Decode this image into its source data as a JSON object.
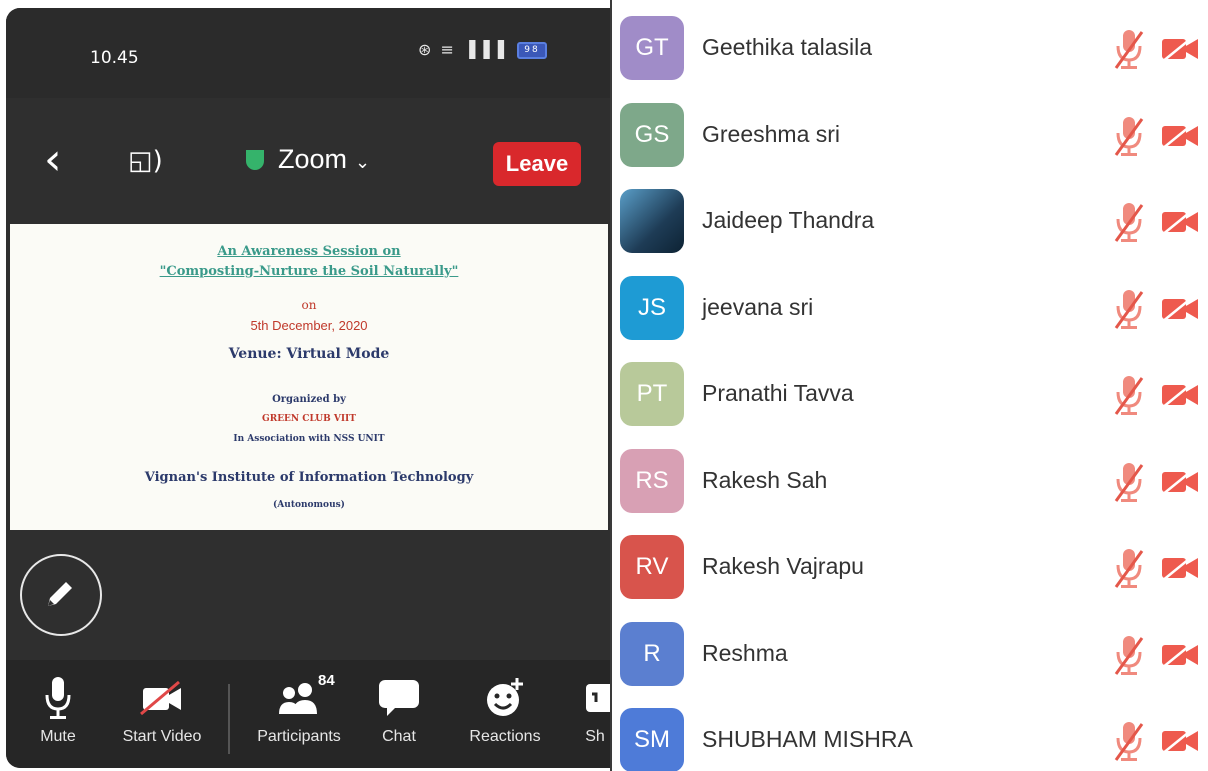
{
  "status_bar": {
    "time": "10.45",
    "signal": "⊛ ≡ ▐▐▐",
    "battery": "98"
  },
  "meeting": {
    "title": "Zoom",
    "leave_label": "Leave"
  },
  "shared_doc": {
    "line1": "An Awareness Session on",
    "line2": "\"Composting-Nurture the Soil Naturally\"",
    "line3": "on",
    "line4": "5th December, 2020",
    "line5": "Venue: Virtual Mode",
    "line6": "Organized by",
    "line7": "GREEN CLUB VIIT",
    "line8": "In Association with NSS UNIT",
    "line9": "Vignan's Institute of Information Technology",
    "line10": "(Autonomous)"
  },
  "toolbar": {
    "mute_label": "Mute",
    "video_label": "Start Video",
    "participants_label": "Participants",
    "participants_count": "84",
    "chat_label": "Chat",
    "reactions_label": "Reactions",
    "share_label": "Sh"
  },
  "participants": [
    {
      "initials": "GT",
      "name": "Geethika talasila",
      "color": "#a08cc8"
    },
    {
      "initials": "GS",
      "name": "Greeshma sri",
      "color": "#7ea88a"
    },
    {
      "initials": "",
      "name": "Jaideep Thandra",
      "color": "#2f5d7e"
    },
    {
      "initials": "JS",
      "name": "jeevana sri",
      "color": "#1e9bd4"
    },
    {
      "initials": "PT",
      "name": "Pranathi Tavva",
      "color": "#b8c99a"
    },
    {
      "initials": "RS",
      "name": "Rakesh Sah",
      "color": "#d8a0b4"
    },
    {
      "initials": "RV",
      "name": "Rakesh Vajrapu",
      "color": "#d8544c"
    },
    {
      "initials": "R",
      "name": "Reshma",
      "color": "#5b7fd0"
    },
    {
      "initials": "SM",
      "name": "SHUBHAM MISHRA",
      "color": "#4e7bd8"
    }
  ]
}
